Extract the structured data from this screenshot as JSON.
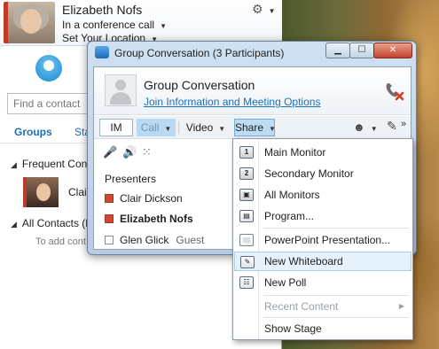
{
  "user": {
    "name": "Elizabeth Nofs",
    "status": "In a conference call",
    "location": "Set Your Location"
  },
  "contacts": {
    "search_placeholder": "Find a contact",
    "tabs": [
      "Groups",
      "Sta"
    ],
    "groups": [
      {
        "label": "Frequent Cont"
      },
      {
        "label": "All Contacts (N"
      }
    ],
    "frequent_contact": "Clair",
    "add_hint": "To add cont"
  },
  "conversation": {
    "window_title": "Group Conversation (3 Participants)",
    "name": "Group Conversation",
    "join_link": "Join Information and Meeting Options",
    "toolbar": {
      "im": "IM",
      "call": "Call",
      "video": "Video",
      "share": "Share",
      "more": "»"
    },
    "presenters_label": "Presenters",
    "participants": [
      {
        "name": "Clair Dickson",
        "role": ""
      },
      {
        "name": "Elizabeth Nofs",
        "role": ""
      },
      {
        "name": "Glen Glick",
        "role": "Guest"
      }
    ]
  },
  "share_menu": {
    "items": [
      {
        "label": "Main Monitor",
        "icon": "monitor-1-icon"
      },
      {
        "label": "Secondary Monitor",
        "icon": "monitor-2-icon"
      },
      {
        "label": "All Monitors",
        "icon": "all-monitors-icon"
      },
      {
        "label": "Program...",
        "icon": "program-icon"
      },
      {
        "label": "PowerPoint Presentation...",
        "icon": "powerpoint-icon"
      },
      {
        "label": "New Whiteboard",
        "icon": "whiteboard-icon",
        "selected": true
      },
      {
        "label": "New Poll",
        "icon": "poll-icon"
      },
      {
        "label": "Recent Content",
        "icon": "",
        "disabled": true,
        "submenu": true
      },
      {
        "label": "Show Stage",
        "icon": ""
      }
    ]
  },
  "colors": {
    "presenter_badge": "#d2452e",
    "link": "#1d6fb8",
    "menu_highlight": "#e6f2fb",
    "share_button": "#bcdcf4"
  }
}
